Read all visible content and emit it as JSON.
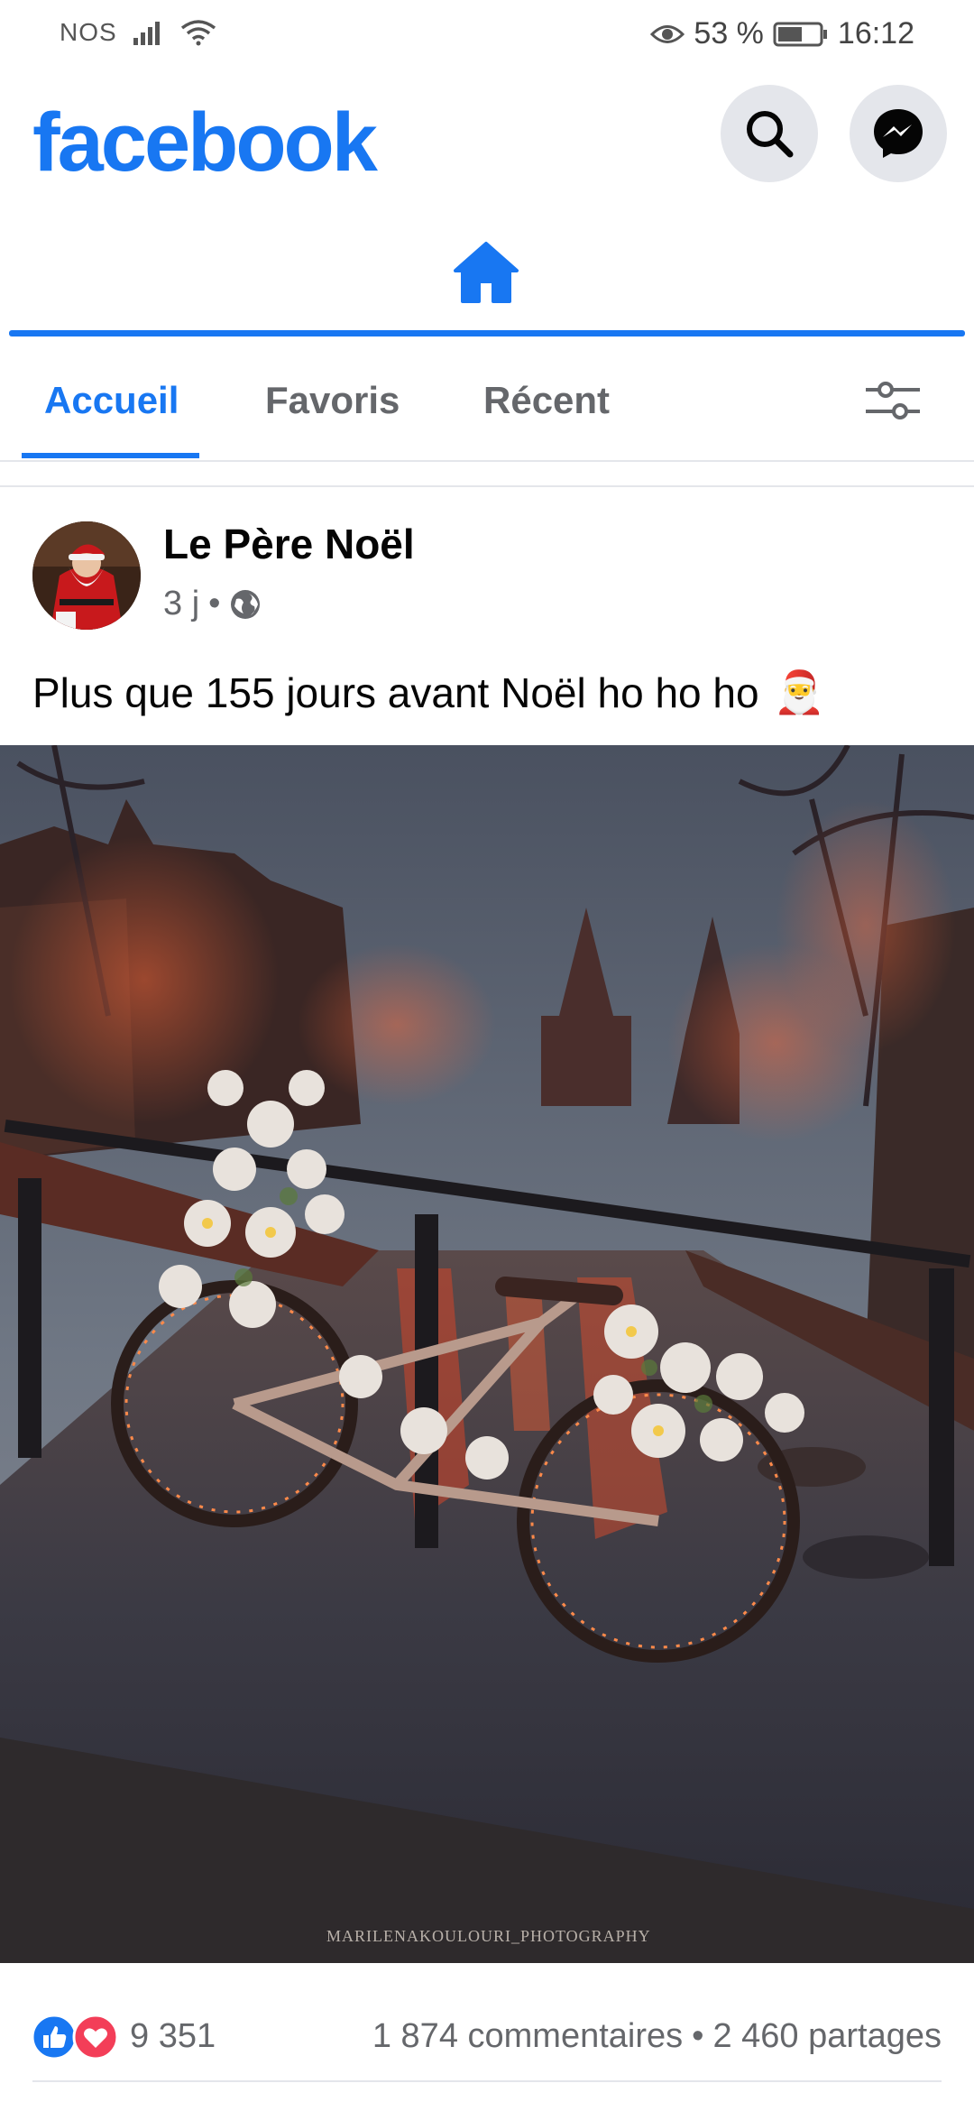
{
  "status_bar": {
    "carrier": "NOS",
    "battery_percent": "53 %",
    "time": "16:12"
  },
  "header": {
    "logo_text": "facebook",
    "search_icon": "search-icon",
    "messenger_icon": "messenger-icon",
    "brand_color": "#1877f2"
  },
  "nav": {
    "home_icon": "home-icon",
    "active": "home"
  },
  "tabs": {
    "items": [
      {
        "label": "Accueil",
        "active": true
      },
      {
        "label": "Favoris",
        "active": false
      },
      {
        "label": "Récent",
        "active": false
      }
    ],
    "filter_icon": "filter-sliders-icon"
  },
  "post": {
    "author": "Le Père Noël",
    "time": "3 j",
    "privacy_icon": "globe-icon",
    "text": "Plus que 155 jours avant Noël ho ho ho",
    "emoji": "🎅",
    "photo_watermark": "MARILENAKOULOURI_PHOTOGRAPHY",
    "reactions": {
      "count": "9 351",
      "comments": "1 874 commentaires",
      "shares": "2 460 partages",
      "separator": "•"
    }
  }
}
